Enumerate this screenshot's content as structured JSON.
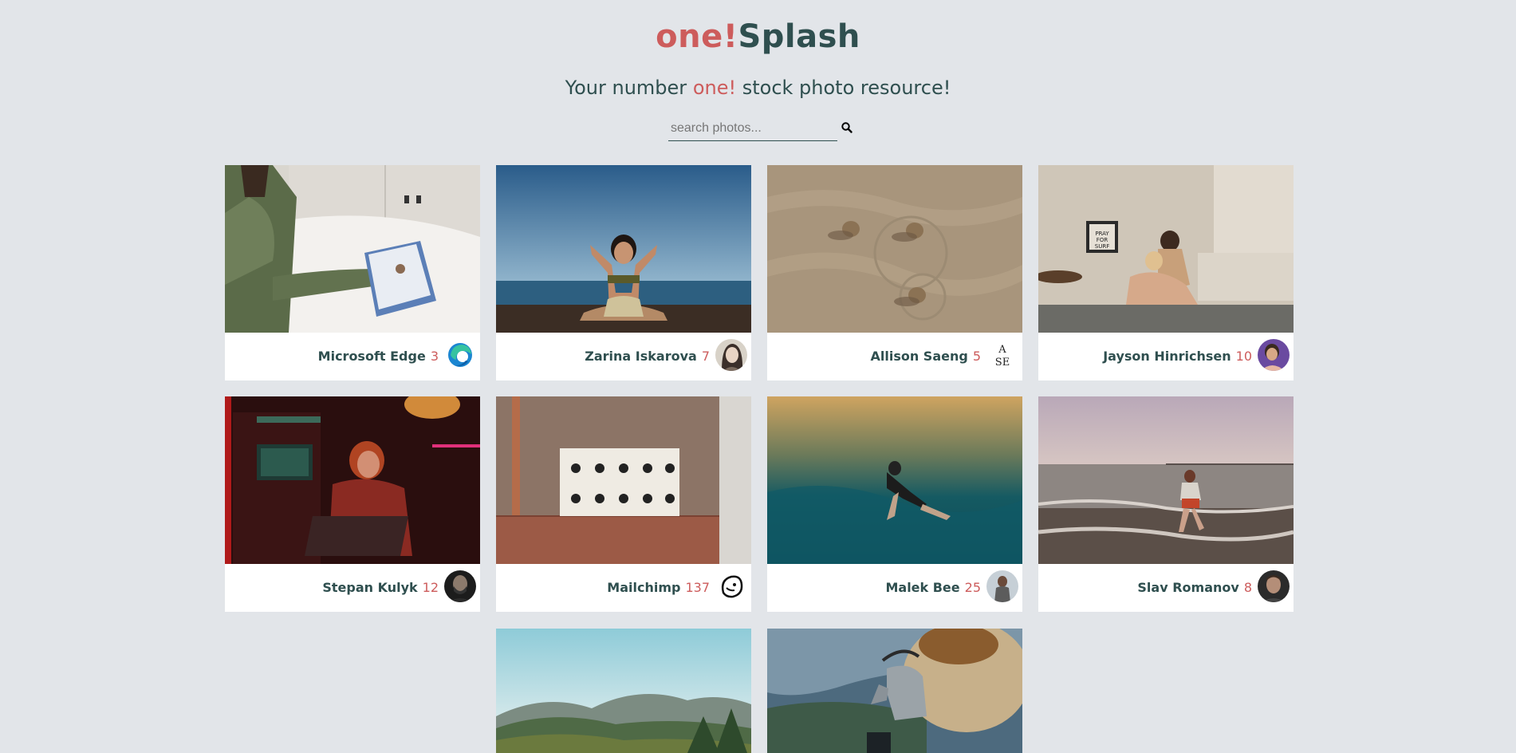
{
  "header": {
    "brand_accent": "one!",
    "brand_main": "Splash",
    "tagline_pre": "Your number",
    "tagline_accent": "one!",
    "tagline_post": "stock photo resource!"
  },
  "search": {
    "placeholder": "search photos...",
    "value": "",
    "button_icon": "search-icon"
  },
  "colors": {
    "background": "#e2e5e9",
    "accent": "#cd5c5c",
    "text": "#2f4f4f",
    "card": "#ffffff"
  },
  "photos": [
    {
      "user": "Microsoft Edge",
      "likes": "3",
      "avatar": "microsoft-edge-logo"
    },
    {
      "user": "Zarina Iskarova",
      "likes": "7",
      "avatar": "portrait"
    },
    {
      "user": "Allison Saeng",
      "likes": "5",
      "avatar": "ase-monogram"
    },
    {
      "user": "Jayson Hinrichsen",
      "likes": "10",
      "avatar": "portrait"
    },
    {
      "user": "Stepan Kulyk",
      "likes": "12",
      "avatar": "portrait"
    },
    {
      "user": "Mailchimp",
      "likes": "137",
      "avatar": "mailchimp-logo"
    },
    {
      "user": "Malek Bee",
      "likes": "25",
      "avatar": "portrait"
    },
    {
      "user": "Slav Romanov",
      "likes": "8",
      "avatar": "portrait"
    },
    {
      "user": "",
      "likes": "",
      "avatar": ""
    },
    {
      "user": "",
      "likes": "",
      "avatar": ""
    }
  ]
}
